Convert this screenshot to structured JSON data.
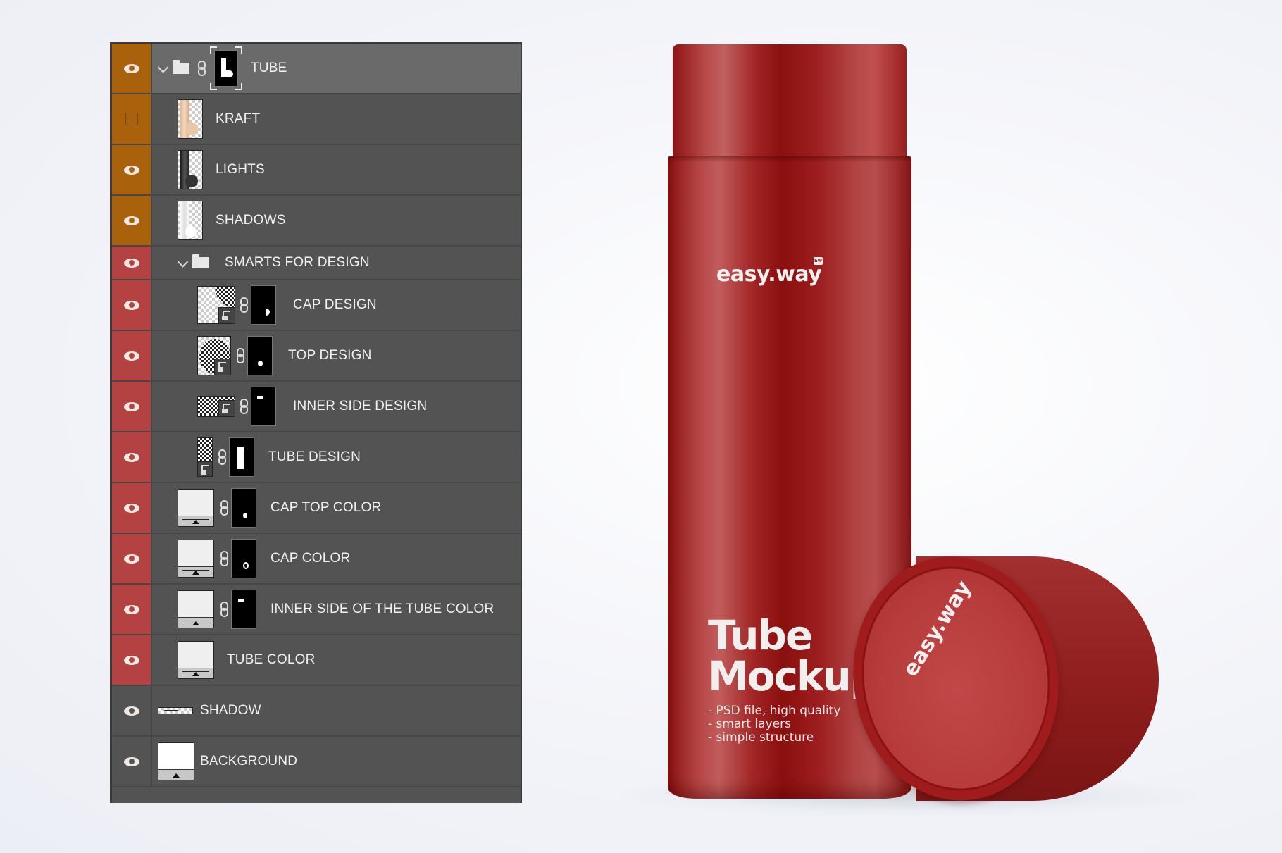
{
  "layers_panel": {
    "layers": [
      {
        "name": "TUBE",
        "type": "group",
        "visible": true,
        "tag_color": "orange",
        "expanded": true,
        "has_link": true,
        "has_mask": true,
        "selected": true,
        "indent": 0
      },
      {
        "name": "KRAFT",
        "type": "pixel",
        "visible": false,
        "tag_color": "orange",
        "indent": 1
      },
      {
        "name": "LIGHTS",
        "type": "pixel",
        "visible": true,
        "tag_color": "orange",
        "indent": 1
      },
      {
        "name": "SHADOWS",
        "type": "pixel",
        "visible": true,
        "tag_color": "orange",
        "indent": 1
      },
      {
        "name": "SMARTS FOR DESIGN",
        "type": "group",
        "visible": true,
        "tag_color": "red",
        "expanded": true,
        "indent": 1
      },
      {
        "name": "CAP DESIGN",
        "type": "smart-object",
        "visible": true,
        "tag_color": "red",
        "has_link": true,
        "has_mask": true,
        "indent": 2
      },
      {
        "name": "TOP DESIGN",
        "type": "smart-object",
        "visible": true,
        "tag_color": "red",
        "has_link": true,
        "has_mask": true,
        "indent": 2
      },
      {
        "name": "INNER SIDE DESIGN",
        "type": "smart-object",
        "visible": true,
        "tag_color": "red",
        "has_link": true,
        "has_mask": true,
        "indent": 2
      },
      {
        "name": "TUBE DESIGN",
        "type": "smart-object",
        "visible": true,
        "tag_color": "red",
        "has_link": true,
        "has_mask": true,
        "indent": 2
      },
      {
        "name": "CAP TOP COLOR",
        "type": "fill",
        "visible": true,
        "tag_color": "red",
        "has_link": true,
        "has_mask": true,
        "indent": 1
      },
      {
        "name": "CAP COLOR",
        "type": "fill",
        "visible": true,
        "tag_color": "red",
        "has_link": true,
        "has_mask": true,
        "indent": 1
      },
      {
        "name": "INNER SIDE OF THE TUBE COLOR",
        "type": "fill",
        "visible": true,
        "tag_color": "red",
        "has_link": true,
        "has_mask": true,
        "indent": 1
      },
      {
        "name": "TUBE COLOR",
        "type": "fill",
        "visible": true,
        "tag_color": "red",
        "indent": 1
      },
      {
        "name": "SHADOW",
        "type": "pixel",
        "visible": true,
        "tag_color": "none",
        "indent": 0
      },
      {
        "name": "BACKGROUND",
        "type": "fill",
        "visible": true,
        "tag_color": "none",
        "indent": 0
      }
    ]
  },
  "product": {
    "brand": "easy.way",
    "brand_badge": "Ew",
    "headline_line1": "Tube",
    "headline_line2": "Mockup",
    "bullets": [
      "- PSD file, high quality",
      "- smart layers",
      "- simple structure"
    ],
    "cap_logo": "easy.way",
    "colors": {
      "tube_red": "#9e1d1d",
      "tag_orange": "#a9620b",
      "tag_red": "#b54242",
      "panel_bg": "#535353"
    }
  }
}
